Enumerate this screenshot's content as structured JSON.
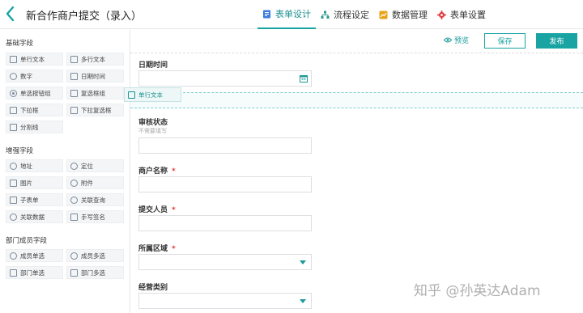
{
  "header": {
    "title": "新合作商户提交（录入）",
    "tabs": [
      {
        "label": "表单设计",
        "icon": "form-icon",
        "active": true
      },
      {
        "label": "流程设定",
        "icon": "flow-icon",
        "active": false
      },
      {
        "label": "数据管理",
        "icon": "data-icon",
        "active": false
      },
      {
        "label": "表单设置",
        "icon": "gear-icon",
        "active": false
      }
    ]
  },
  "left": {
    "basic_title": "基础字段",
    "basic": [
      "单行文本",
      "多行文本",
      "数字",
      "日期时间",
      "单选按钮组",
      "复选框组",
      "下拉框",
      "下拉复选框",
      "分割线"
    ],
    "enhanced_title": "增强字段",
    "enhanced": [
      "地址",
      "定位",
      "图片",
      "附件",
      "子表单",
      "关联查询",
      "关联数据",
      "手写签名"
    ],
    "dept_title": "部门成员字段",
    "dept": [
      "成员单选",
      "成员多选",
      "部门单选",
      "部门多选"
    ]
  },
  "toolbar": {
    "preview": "预览",
    "save": "保存",
    "publish": "发布"
  },
  "drag": {
    "label": "单行文本"
  },
  "form": {
    "datetime_label": "日期时间",
    "audit_label": "审核状态",
    "audit_hint": "不需要填写",
    "merchant_label": "商户名称",
    "submitter_label": "提交人员",
    "region_label": "所属区域",
    "category_label": "经营类别",
    "required_mark": "*"
  },
  "watermark": "知乎 @孙英达Adam",
  "colors": {
    "accent": "#1aa3a3",
    "required": "#e0393e",
    "tab_form": "#3b7ddd",
    "tab_flow": "#2a9a8a",
    "tab_data": "#e8a317",
    "tab_settings": "#e0393e"
  }
}
